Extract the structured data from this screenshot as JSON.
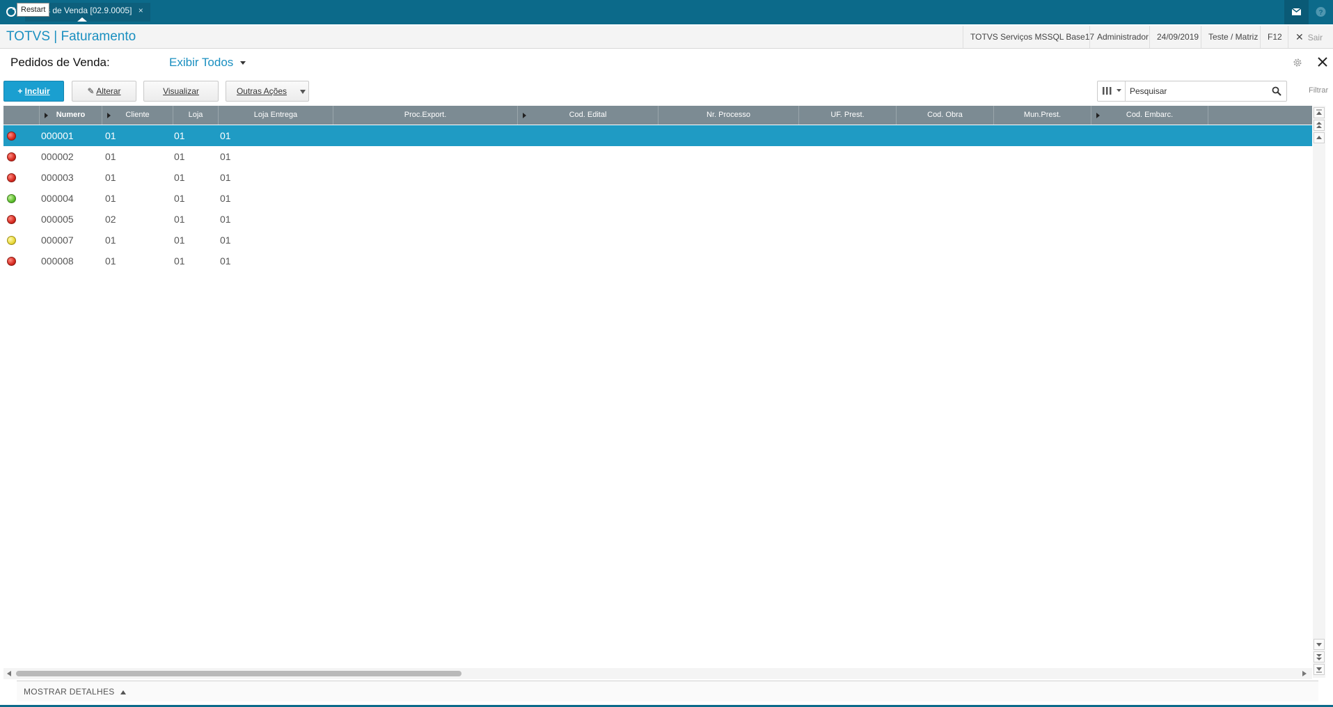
{
  "topbar": {
    "tab_label": "s de Venda [02.9.0005]",
    "tab_close": "×",
    "tooltip": "Restart",
    "icons": {
      "restart": "refresh-icon",
      "mail": "mail-icon",
      "help": "help-icon"
    }
  },
  "titlebar": {
    "app_title": "TOTVS | Faturamento",
    "environment": "TOTVS Serviços MSSQL Base17",
    "user": "Administrador",
    "date": "24/09/2019",
    "branch": "Teste / Matriz",
    "shortcut": "F12",
    "exit_label": "Sair"
  },
  "page": {
    "label": "Pedidos de Venda:",
    "view_filter": "Exibir Todos"
  },
  "toolbar": {
    "incluir": "Incluir",
    "alterar": "Alterar",
    "visualizar": "Visualizar",
    "outras": "Outras Ações",
    "search_placeholder": "Pesquisar",
    "filter_label": "Filtrar"
  },
  "grid": {
    "columns": [
      "",
      "Numero",
      "Cliente",
      "Loja",
      "Loja Entrega",
      "Proc.Export.",
      "Cod. Edital",
      "Nr. Processo",
      "UF. Prest.",
      "Cod. Obra",
      "Mun.Prest.",
      "Cod. Embarc."
    ],
    "rows": [
      {
        "status": "red",
        "numero": "000001",
        "cliente": "01",
        "loja": "01",
        "loja_entrega": "01"
      },
      {
        "status": "red",
        "numero": "000002",
        "cliente": "01",
        "loja": "01",
        "loja_entrega": "01"
      },
      {
        "status": "red",
        "numero": "000003",
        "cliente": "01",
        "loja": "01",
        "loja_entrega": "01"
      },
      {
        "status": "green",
        "numero": "000004",
        "cliente": "01",
        "loja": "01",
        "loja_entrega": "01"
      },
      {
        "status": "red",
        "numero": "000005",
        "cliente": "02",
        "loja": "01",
        "loja_entrega": "01"
      },
      {
        "status": "yellow",
        "numero": "000007",
        "cliente": "01",
        "loja": "01",
        "loja_entrega": "01"
      },
      {
        "status": "red",
        "numero": "000008",
        "cliente": "01",
        "loja": "01",
        "loja_entrega": "01"
      }
    ],
    "selected_row": 0
  },
  "footer": {
    "details_label": "MOSTRAR DETALHES"
  },
  "colors": {
    "topbar": "#0c6a8a",
    "accent": "#1a8fc0",
    "selected_row": "#1f9bc4",
    "header": "#7c8b93"
  }
}
